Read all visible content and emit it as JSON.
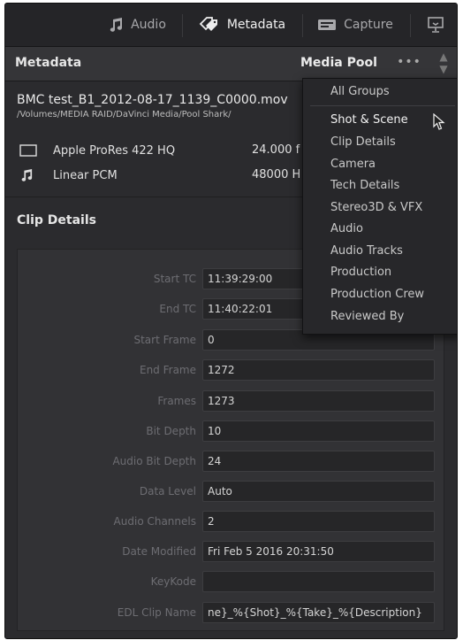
{
  "tabs": [
    {
      "label": "Audio",
      "icon": "music-note-icon",
      "active": false
    },
    {
      "label": "Metadata",
      "icon": "metadata-tags-icon",
      "active": true
    },
    {
      "label": "Capture",
      "icon": "capture-icon",
      "active": false
    },
    {
      "label": "",
      "icon": "monitor-icon",
      "active": false
    }
  ],
  "header": {
    "title": "Metadata",
    "pool_label": "Media Pool",
    "more_label": "•••"
  },
  "clip": {
    "name": "BMC test_B1_2012-08-17_1139_C0000.mov",
    "path": "/Volumes/MEDIA RAID/DaVinci Media/Pool Shark/",
    "video": {
      "codec": "Apple ProRes 422 HQ",
      "value": "24.000 f",
      "icon": "video-frame-icon"
    },
    "audio": {
      "codec": "Linear PCM",
      "value": "48000 H",
      "icon": "music-note-icon"
    }
  },
  "section_title": "Clip Details",
  "fields": [
    {
      "label": "Start TC",
      "value": "11:39:29:00"
    },
    {
      "label": "End TC",
      "value": "11:40:22:01"
    },
    {
      "label": "Start Frame",
      "value": "0"
    },
    {
      "label": "End Frame",
      "value": "1272"
    },
    {
      "label": "Frames",
      "value": "1273"
    },
    {
      "label": "Bit Depth",
      "value": "10"
    },
    {
      "label": "Audio Bit Depth",
      "value": "24"
    },
    {
      "label": "Data Level",
      "value": "Auto"
    },
    {
      "label": "Audio Channels",
      "value": "2"
    },
    {
      "label": "Date Modified",
      "value": "Fri Feb 5 2016 20:31:50"
    },
    {
      "label": "KeyKode",
      "value": ""
    },
    {
      "label": "EDL Clip Name",
      "value": "ne}_%{Shot}_%{Take}_%{Description}"
    }
  ],
  "menu": {
    "items": [
      "All Groups",
      "Shot & Scene",
      "Clip Details",
      "Camera",
      "Tech Details",
      "Stereo3D & VFX",
      "Audio",
      "Audio Tracks",
      "Production",
      "Production Crew",
      "Reviewed By"
    ],
    "hovered": "Shot & Scene"
  },
  "colors": {
    "background": "#2b2b2e",
    "panel": "#323235",
    "field": "#262628",
    "menu": "#27272a"
  }
}
